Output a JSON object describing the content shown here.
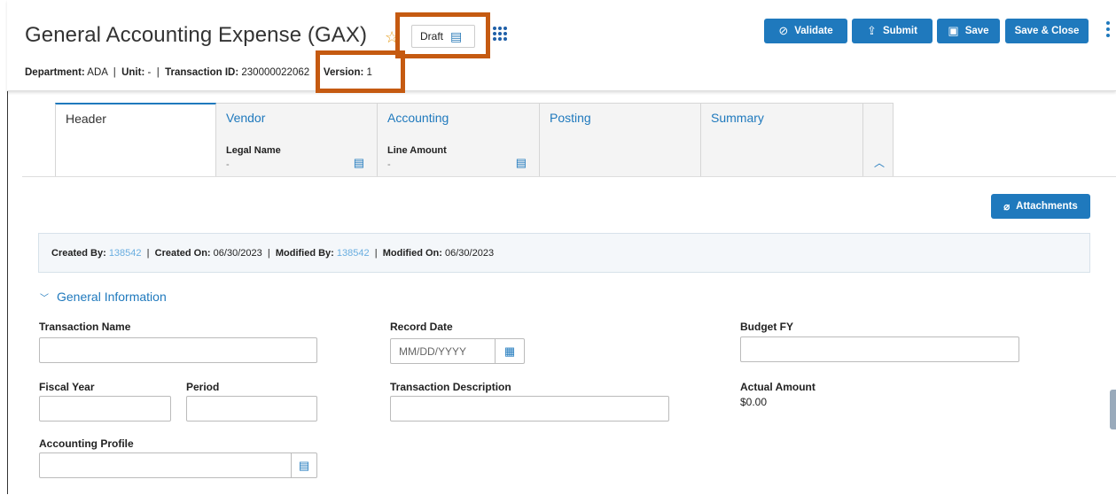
{
  "header": {
    "title": "General Accounting Expense (GAX)",
    "status_label": "Draft",
    "info": {
      "department_label": "Department:",
      "department_value": "ADA",
      "unit_label": "Unit:",
      "unit_value": "-",
      "transaction_id_label": "Transaction ID:",
      "transaction_id_value": "230000022062",
      "version_label": "Version:",
      "version_value": "1",
      "separator": "|"
    },
    "buttons": {
      "validate": "Validate",
      "submit": "Submit",
      "save": "Save",
      "save_close": "Save & Close"
    }
  },
  "tabs": [
    {
      "label": "Header"
    },
    {
      "label": "Vendor",
      "sub_label": "Legal Name",
      "sub_value": "-"
    },
    {
      "label": "Accounting",
      "sub_label": "Line Amount",
      "sub_value": "-"
    },
    {
      "label": "Posting"
    },
    {
      "label": "Summary"
    }
  ],
  "attachments_label": "Attachments",
  "meta": {
    "created_by_label": "Created By:",
    "created_by_value": "138542",
    "created_on_label": "Created On:",
    "created_on_value": "06/30/2023",
    "modified_by_label": "Modified By:",
    "modified_by_value": "138542",
    "modified_on_label": "Modified On:",
    "modified_on_value": "06/30/2023",
    "separator": "|"
  },
  "section": {
    "title": "General Information"
  },
  "fields": {
    "transaction_name": {
      "label": "Transaction Name",
      "value": ""
    },
    "record_date": {
      "label": "Record Date",
      "placeholder": "MM/DD/YYYY"
    },
    "budget_fy": {
      "label": "Budget FY",
      "value": ""
    },
    "fiscal_year": {
      "label": "Fiscal Year",
      "value": ""
    },
    "period": {
      "label": "Period",
      "value": ""
    },
    "transaction_description": {
      "label": "Transaction Description",
      "value": ""
    },
    "actual_amount": {
      "label": "Actual Amount",
      "value": "$0.00"
    },
    "accounting_profile": {
      "label": "Accounting Profile",
      "value": ""
    }
  },
  "colors": {
    "primary": "#1f79bd",
    "highlight": "#c55a11",
    "star": "#e6a020",
    "link": "#6aaee0"
  },
  "icons": [
    "star-icon",
    "document-icon",
    "apps-grid-icon",
    "check-circle-icon",
    "submit-icon",
    "floppy-disk-icon",
    "kebab-menu-icon",
    "paperclip-icon",
    "chevron-up-icon",
    "chevron-down-icon",
    "calendar-icon",
    "lookup-icon"
  ]
}
